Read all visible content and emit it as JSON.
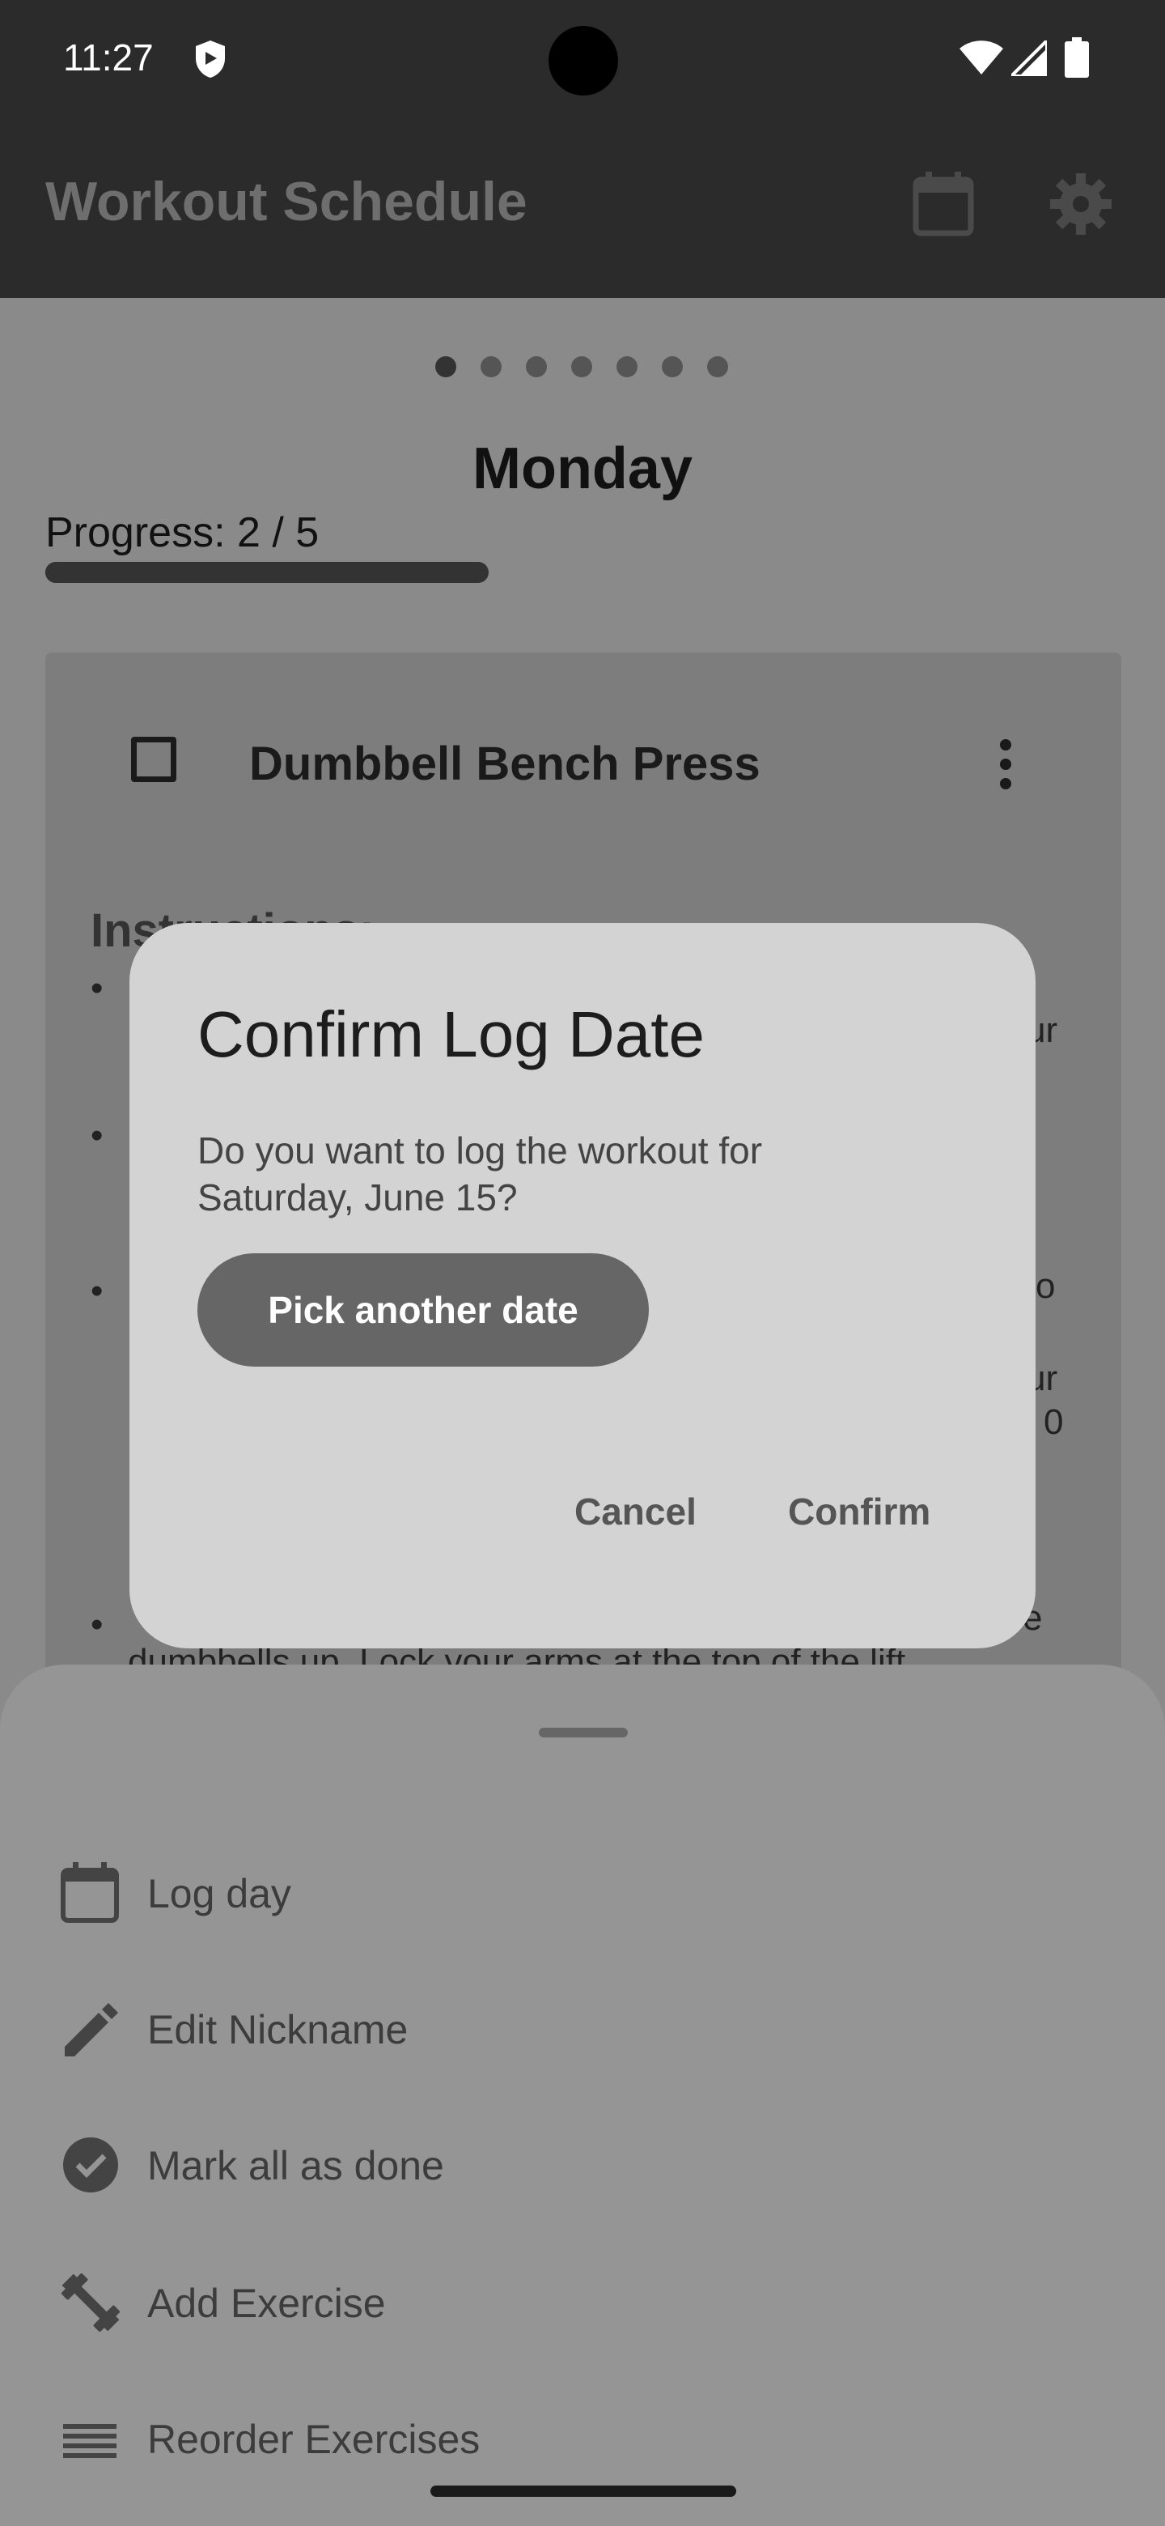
{
  "status_bar": {
    "time": "11:27"
  },
  "app_bar": {
    "title": "Workout Schedule"
  },
  "pager": {
    "page_count": 7,
    "active_index": 0
  },
  "day": {
    "title": "Monday"
  },
  "progress": {
    "label": "Progress: 2 / 5",
    "completed": 2,
    "total": 5
  },
  "exercise_card": {
    "title": "Dumbbell Bench Press",
    "instructions_heading": "Instructions:",
    "visible_fragments": [
      "ur",
      "o",
      "ur",
      "0",
      "e",
      "dumbbells up. Lock your arms at the top of the lift"
    ]
  },
  "dialog": {
    "title": "Confirm Log Date",
    "body": "Do you want to log the workout for Saturday, June 15?",
    "pick_another_label": "Pick another date",
    "cancel_label": "Cancel",
    "confirm_label": "Confirm"
  },
  "bottom_sheet": {
    "items": [
      {
        "label": "Log day",
        "icon": "calendar-icon"
      },
      {
        "label": "Edit Nickname",
        "icon": "pencil-icon"
      },
      {
        "label": "Mark all as done",
        "icon": "check-circle-icon"
      },
      {
        "label": "Add Exercise",
        "icon": "dumbbell-icon"
      },
      {
        "label": "Reorder Exercises",
        "icon": "reorder-icon"
      }
    ]
  },
  "colors": {
    "scrim": "#8a8a8a",
    "dialog_bg": "#d3d3d3",
    "primary_button": "#666666"
  }
}
